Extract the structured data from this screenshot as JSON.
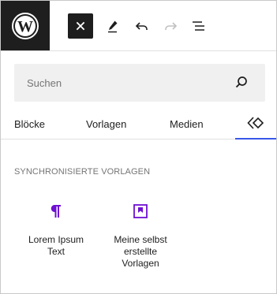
{
  "toolbar": {
    "logo_icon": "wordpress-logo",
    "close_icon": "close-icon",
    "edit_icon": "pencil-icon",
    "undo_icon": "undo-icon",
    "redo_icon": "redo-icon",
    "list_view_icon": "list-view-icon"
  },
  "search": {
    "placeholder": "Suchen",
    "icon": "search-icon"
  },
  "tabs": [
    {
      "label": "Blöcke"
    },
    {
      "label": "Vorlagen"
    },
    {
      "label": "Medien"
    },
    {
      "icon": "synced-patterns-icon",
      "active": true
    }
  ],
  "section": {
    "title": "SYNCHRONISIERTE VORLAGEN",
    "items": [
      {
        "icon": "pilcrow-icon",
        "label": "Lorem Ipsum Text"
      },
      {
        "icon": "bookmark-icon",
        "label": "Meine selbst erstellte Vorlagen"
      }
    ]
  },
  "colors": {
    "dark": "#1e1e1e",
    "accent_purple": "#6f0fd1",
    "tab_underline": "#3858e9",
    "search_bg": "#f0f0f0",
    "muted_text": "#757575"
  }
}
